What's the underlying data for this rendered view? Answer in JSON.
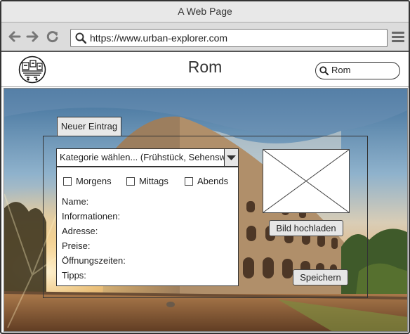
{
  "browser": {
    "window_title": "A Web Page",
    "url": "https://www.urban-explorer.com",
    "icons": [
      "back-arrow-icon",
      "forward-arrow-icon",
      "reload-icon",
      "search-icon",
      "hamburger-menu-icon"
    ]
  },
  "header": {
    "title": "Rom",
    "search": {
      "value": "Rom",
      "icon": "search-icon"
    },
    "logo_icon": "city-logo-icon"
  },
  "form": {
    "tab_label": "Neuer Eintrag",
    "category_dropdown": "Kategorie wählen... (Frühstück, Sehenswürdigkeiten",
    "time_options": [
      {
        "label": "Morgens",
        "checked": false
      },
      {
        "label": "Mittags",
        "checked": false
      },
      {
        "label": "Abends",
        "checked": false
      }
    ],
    "fields": [
      "Name:",
      "Informationen:",
      "Adresse:",
      "Preise:",
      "Öffnungszeiten:",
      "Tipps:"
    ],
    "upload_button": "Bild hochladen",
    "save_button": "Speichern"
  },
  "colors": {
    "chrome_bg": "#dcdcdc",
    "button_bg": "#e6e6e6",
    "border": "#333333"
  }
}
